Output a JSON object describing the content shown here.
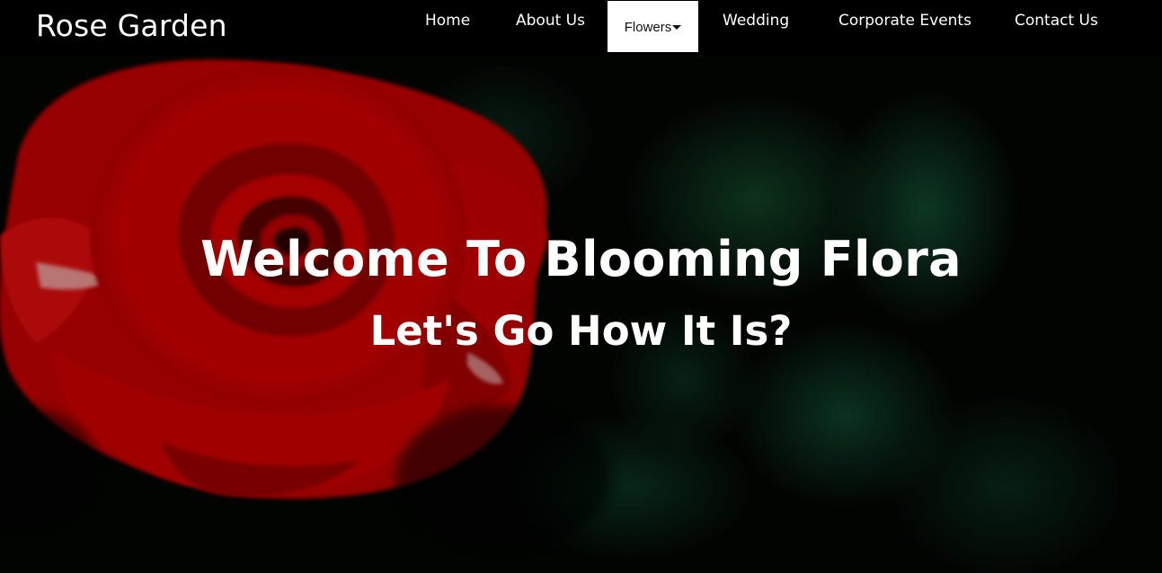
{
  "header": {
    "brand": "Rose Garden",
    "nav": {
      "home": "Home",
      "about": "About Us",
      "flowers": "Flowers",
      "wedding": "Wedding",
      "corporate": "Corporate Events",
      "contact": "Contact Us"
    },
    "active_item": "Flowers",
    "dropdown_icon": "caret-down-icon"
  },
  "hero": {
    "title": "Welcome To Blooming Flora",
    "subtitle": "Let's Go How It Is?",
    "background_image": "red rose with blurred green leaves"
  },
  "colors": {
    "navbar_bg": "#000000",
    "nav_text": "#ffffff",
    "active_nav_bg": "#ffffff",
    "active_nav_text": "#111111",
    "rose_red": "#c40000",
    "leaf_green": "#1d6a45"
  }
}
